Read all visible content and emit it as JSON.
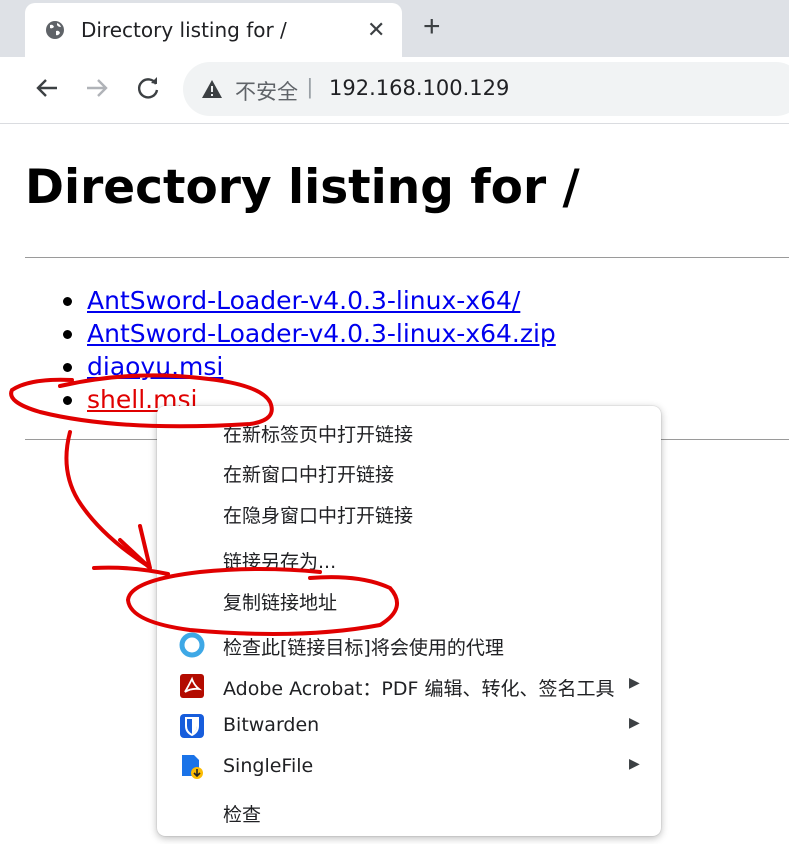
{
  "browser": {
    "tab": {
      "title": "Directory listing for /",
      "close_symbol": "✕"
    },
    "new_tab_symbol": "+",
    "toolbar": {
      "back_icon": "arrow-left-icon",
      "forward_icon": "arrow-right-icon",
      "reload_icon": "reload-icon",
      "security_label": "不安全",
      "separator": "|",
      "url": "192.168.100.129"
    }
  },
  "page": {
    "heading": "Directory listing for /",
    "files": [
      {
        "name": "AntSword-Loader-v4.0.3-linux-x64/"
      },
      {
        "name": "AntSword-Loader-v4.0.3-linux-x64.zip"
      },
      {
        "name": "diaoyu.msi"
      },
      {
        "name": "shell.msi"
      }
    ]
  },
  "context_menu": {
    "items": [
      {
        "label": "在新标签页中打开链接"
      },
      {
        "label": "在新窗口中打开链接"
      },
      {
        "label": "在隐身窗口中打开链接"
      },
      {
        "label": "链接另存为..."
      },
      {
        "label": "复制链接地址"
      },
      {
        "label": "检查此[链接目标]将会使用的代理",
        "icon": "proxy-circle-icon"
      },
      {
        "label": "Adobe Acrobat：PDF 编辑、转化、签名工具",
        "icon": "adobe-acrobat-icon",
        "submenu": true
      },
      {
        "label": "Bitwarden",
        "icon": "bitwarden-shield-icon",
        "submenu": true
      },
      {
        "label": "SingleFile",
        "icon": "singlefile-icon",
        "submenu": true
      },
      {
        "label": "检查"
      }
    ],
    "submenu_arrow": "▶"
  },
  "colors": {
    "link": "#0000ee",
    "active_link": "#e00000",
    "annotation": "#e00000",
    "tabstrip": "#dee1e6",
    "acrobat": "#b30b00",
    "bitwarden": "#175ddc",
    "proxy": "#3ea8e6"
  }
}
